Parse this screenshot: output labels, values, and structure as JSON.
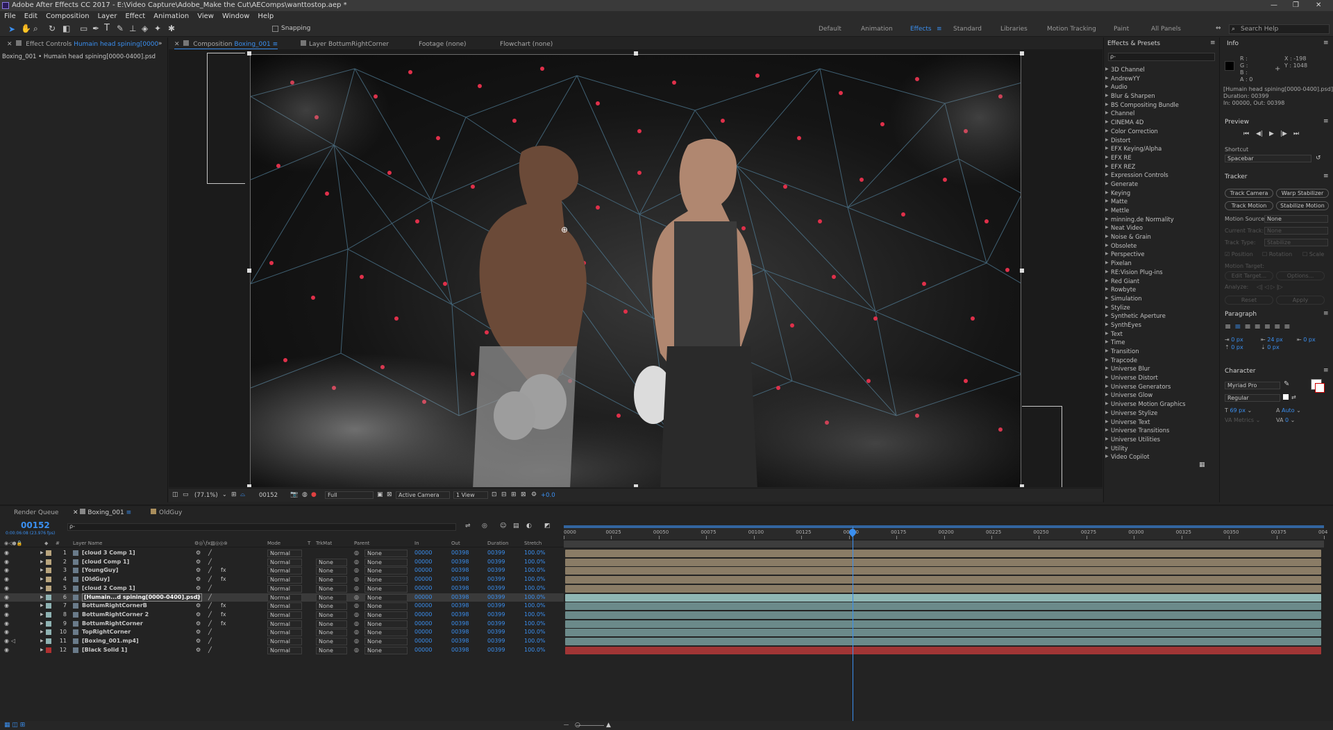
{
  "app": {
    "title": "Adobe After Effects CC 2017 - E:\\Video Capture\\Adobe_Make the Cut\\AEComps\\wanttostop.aep *"
  },
  "menu": [
    "File",
    "Edit",
    "Composition",
    "Layer",
    "Effect",
    "Animation",
    "View",
    "Window",
    "Help"
  ],
  "toolbar": {
    "snapping": "Snapping",
    "search_placeholder": "Search Help"
  },
  "workspaces": [
    "Default",
    "Animation",
    "Effects",
    "Standard",
    "Libraries",
    "Motion Tracking",
    "Paint",
    "All Panels"
  ],
  "active_workspace": "Effects",
  "left_panel": {
    "tab": "Effect Controls",
    "tab_target": "Humain head spining[0000",
    "breadcrumb": "Boxing_001 • Humain head spining[0000-0400].psd"
  },
  "comp_tabs": {
    "composition_label": "Composition",
    "composition_name": "Boxing_001",
    "layer": "Layer BottumRightCorner",
    "footage": "Footage (none)",
    "flowchart": "Flowchart (none)"
  },
  "viewer_footer": {
    "zoom": "(77.1%)",
    "timecode": "00152",
    "resolution": "Full",
    "camera": "Active Camera",
    "views": "1 View",
    "exposure": "+0.0"
  },
  "effects_presets": {
    "title": "Effects & Presets",
    "search_placeholder": "ρ-",
    "items": [
      "3D Channel",
      "AndrewYY",
      "Audio",
      "Blur & Sharpen",
      "BS Compositing Bundle",
      "Channel",
      "CINEMA 4D",
      "Color Correction",
      "Distort",
      "EFX Keying/Alpha",
      "EFX RE",
      "EFX REZ",
      "Expression Controls",
      "Generate",
      "Keying",
      "Matte",
      "Mettle",
      "minning.de Normality",
      "Neat Video",
      "Noise & Grain",
      "Obsolete",
      "Perspective",
      "Pixelan",
      "RE:Vision Plug-ins",
      "Red Giant",
      "Rowbyte",
      "Simulation",
      "Stylize",
      "Synthetic Aperture",
      "SynthEyes",
      "Text",
      "Time",
      "Transition",
      "Trapcode",
      "Universe Blur",
      "Universe Distort",
      "Universe Generators",
      "Universe Glow",
      "Universe Motion Graphics",
      "Universe Stylize",
      "Universe Text",
      "Universe Transitions",
      "Universe Utilities",
      "Utility",
      "Video Copilot"
    ]
  },
  "info": {
    "title": "Info",
    "r": "R :",
    "g": "G :",
    "b": "B :",
    "a": "A : 0",
    "x": "X : -198",
    "y": "Y : 1048",
    "layer": "[Humain head spining[0000-0400].psd]",
    "duration": "Duration: 00399",
    "inout": "In: 00000, Out: 00398"
  },
  "preview": {
    "title": "Preview",
    "shortcut_label": "Shortcut",
    "shortcut_value": "Spacebar"
  },
  "tracker": {
    "title": "Tracker",
    "track_camera": "Track Camera",
    "warp_stabilizer": "Warp Stabilizer",
    "track_motion": "Track Motion",
    "stabilize_motion": "Stabilize Motion",
    "motion_source_label": "Motion Source:",
    "motion_source_value": "None",
    "current_track_label": "Current Track:",
    "current_track_value": "None",
    "track_type_label": "Track Type:",
    "track_type_value": "Stabilize",
    "position": "Position",
    "rotation": "Rotation",
    "scale": "Scale",
    "motion_target": "Motion Target:",
    "edit_target": "Edit Target...",
    "options": "Options...",
    "analyze": "Analyze:",
    "reset": "Reset",
    "apply": "Apply"
  },
  "paragraph": {
    "title": "Paragraph",
    "v1": "0 px",
    "v2": "24 px",
    "v3": "0 px",
    "v4": "0 px",
    "v5": "0 px"
  },
  "character": {
    "title": "Character",
    "font": "Myriad Pro",
    "style": "Regular",
    "size": "69 px",
    "leading": "Auto",
    "metrics": "Metrics",
    "tracking": "0"
  },
  "timeline": {
    "tabs": [
      "Render Queue",
      "Boxing_001",
      "OldGuy"
    ],
    "timecode": "00152",
    "fps": "0:00:06:08 (23.976 fps)",
    "search_placeholder": "ρ-",
    "columns": {
      "layer_name": "Layer Name",
      "mode": "Mode",
      "t": "T",
      "trkmat": "TrkMat",
      "parent": "Parent",
      "in": "In",
      "out": "Out",
      "duration": "Duration",
      "stretch": "Stretch"
    },
    "ruler": [
      "0000",
      "00025",
      "00050",
      "00075",
      "00100",
      "00125",
      "00150",
      "00175",
      "00200",
      "00225",
      "00250",
      "00275",
      "00300",
      "00325",
      "00350",
      "00375",
      "004"
    ],
    "layers": [
      {
        "num": "1",
        "name": "[cloud 3 Comp 1]",
        "mode": "Normal",
        "trkmat": "",
        "parent": "None",
        "in": "00000",
        "out": "00398",
        "dur": "00399",
        "stretch": "100.0%",
        "color": "#b9a57e",
        "bar": "#8a7c66"
      },
      {
        "num": "2",
        "name": "[cloud Comp 1]",
        "mode": "Normal",
        "trkmat": "None",
        "parent": "None",
        "in": "00000",
        "out": "00398",
        "dur": "00399",
        "stretch": "100.0%",
        "color": "#b9a57e",
        "bar": "#8a7c66"
      },
      {
        "num": "3",
        "name": "[YoungGuy]",
        "mode": "Normal",
        "trkmat": "None",
        "parent": "None",
        "in": "00000",
        "out": "00398",
        "dur": "00399",
        "stretch": "100.0%",
        "color": "#b9a57e",
        "bar": "#8a7c66"
      },
      {
        "num": "4",
        "name": "[OldGuy]",
        "mode": "Normal",
        "trkmat": "None",
        "parent": "None",
        "in": "00000",
        "out": "00398",
        "dur": "00399",
        "stretch": "100.0%",
        "color": "#b9a57e",
        "bar": "#8a7c66"
      },
      {
        "num": "5",
        "name": "[cloud 2 Comp 1]",
        "mode": "Normal",
        "trkmat": "None",
        "parent": "None",
        "in": "00000",
        "out": "00398",
        "dur": "00399",
        "stretch": "100.0%",
        "color": "#b9a57e",
        "bar": "#8a7c66"
      },
      {
        "num": "6",
        "name": "[Humain...d spining[0000-0400].psd]",
        "mode": "Normal",
        "trkmat": "None",
        "parent": "None",
        "in": "00000",
        "out": "00398",
        "dur": "00399",
        "stretch": "100.0%",
        "color": "#8fb3b3",
        "bar": "#8fb6b4",
        "selected": true
      },
      {
        "num": "7",
        "name": "BottumRightCornerB",
        "mode": "Normal",
        "trkmat": "None",
        "parent": "None",
        "in": "00000",
        "out": "00398",
        "dur": "00399",
        "stretch": "100.0%",
        "color": "#8fb3b3",
        "bar": "#6b8a8a"
      },
      {
        "num": "8",
        "name": "BottumRightCorner 2",
        "mode": "Normal",
        "trkmat": "None",
        "parent": "None",
        "in": "00000",
        "out": "00398",
        "dur": "00399",
        "stretch": "100.0%",
        "color": "#8fb3b3",
        "bar": "#6b8a8a"
      },
      {
        "num": "9",
        "name": "BottumRightCorner",
        "mode": "Normal",
        "trkmat": "None",
        "parent": "None",
        "in": "00000",
        "out": "00398",
        "dur": "00399",
        "stretch": "100.0%",
        "color": "#8fb3b3",
        "bar": "#6b8a8a"
      },
      {
        "num": "10",
        "name": "TopRightCorner",
        "mode": "Normal",
        "trkmat": "None",
        "parent": "None",
        "in": "00000",
        "out": "00398",
        "dur": "00399",
        "stretch": "100.0%",
        "color": "#8fb3b3",
        "bar": "#6b8a8a"
      },
      {
        "num": "11",
        "name": "[Boxing_001.mp4]",
        "mode": "Normal",
        "trkmat": "None",
        "parent": "None",
        "in": "00000",
        "out": "00398",
        "dur": "00399",
        "stretch": "100.0%",
        "color": "#8fb3b3",
        "bar": "#6b8a8a"
      },
      {
        "num": "12",
        "name": "[Black Solid 1]",
        "mode": "Normal",
        "trkmat": "None",
        "parent": "None",
        "in": "00000",
        "out": "00398",
        "dur": "00399",
        "stretch": "100.0%",
        "color": "#b03030",
        "bar": "#a13535"
      }
    ]
  }
}
